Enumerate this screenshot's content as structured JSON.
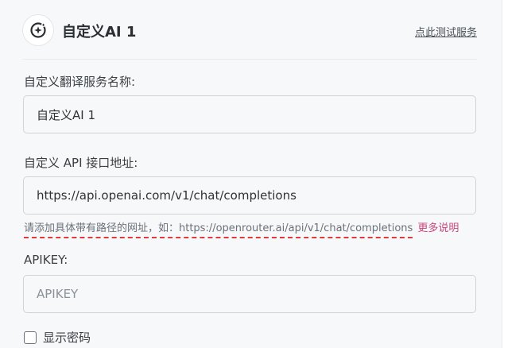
{
  "header": {
    "title": "自定义AI 1",
    "test_link": "点此测试服务",
    "logo_icon": "sparkle-icon"
  },
  "fields": {
    "name": {
      "label": "自定义翻译服务名称:",
      "value": "自定义AI 1"
    },
    "api_url": {
      "label": "自定义 API 接口地址:",
      "value": "https://api.openai.com/v1/chat/completions",
      "hint": "请添加具体带有路径的网址，如：https://openrouter.ai/api/v1/chat/completions",
      "more_link": "更多说明"
    },
    "api_key": {
      "label": "APIKEY:",
      "value": "",
      "placeholder": "APIKEY"
    },
    "show_password": {
      "label": "显示密码",
      "checked": false
    }
  },
  "colors": {
    "accent_link": "#c7447a",
    "hint_underline": "#e23a3a"
  }
}
